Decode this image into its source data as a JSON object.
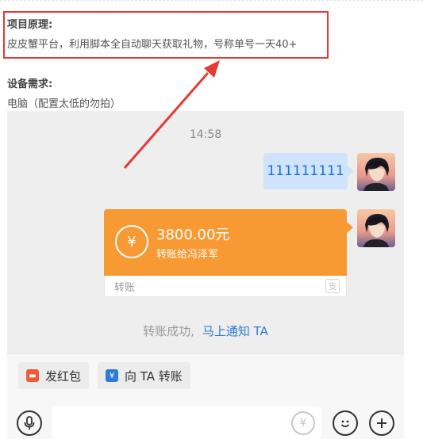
{
  "project": {
    "title": "项目原理:",
    "text": "皮皮蟹平台，利用脚本全自动聊天获取礼物，号称单号一天40+"
  },
  "device": {
    "title": "设备需求:",
    "text": "电脑（配置太低的勿拍）"
  },
  "chat": {
    "time": "14:58",
    "message": "111111111",
    "transfer": {
      "icon": "yen-transfer-icon",
      "amount": "3800.00元",
      "to": "转账给冯泽军",
      "label": "转账"
    },
    "status": {
      "text": "转账成功,",
      "link": "马上通知 TA"
    }
  },
  "actions": {
    "red_packet": "发红包",
    "transfer_to": "向 TA 转账"
  },
  "colors": {
    "highlight": "#e53935",
    "transfer_orange": "#f79a33",
    "bubble_blue": "#cfe3fb",
    "link_blue": "#2d7bd6"
  }
}
